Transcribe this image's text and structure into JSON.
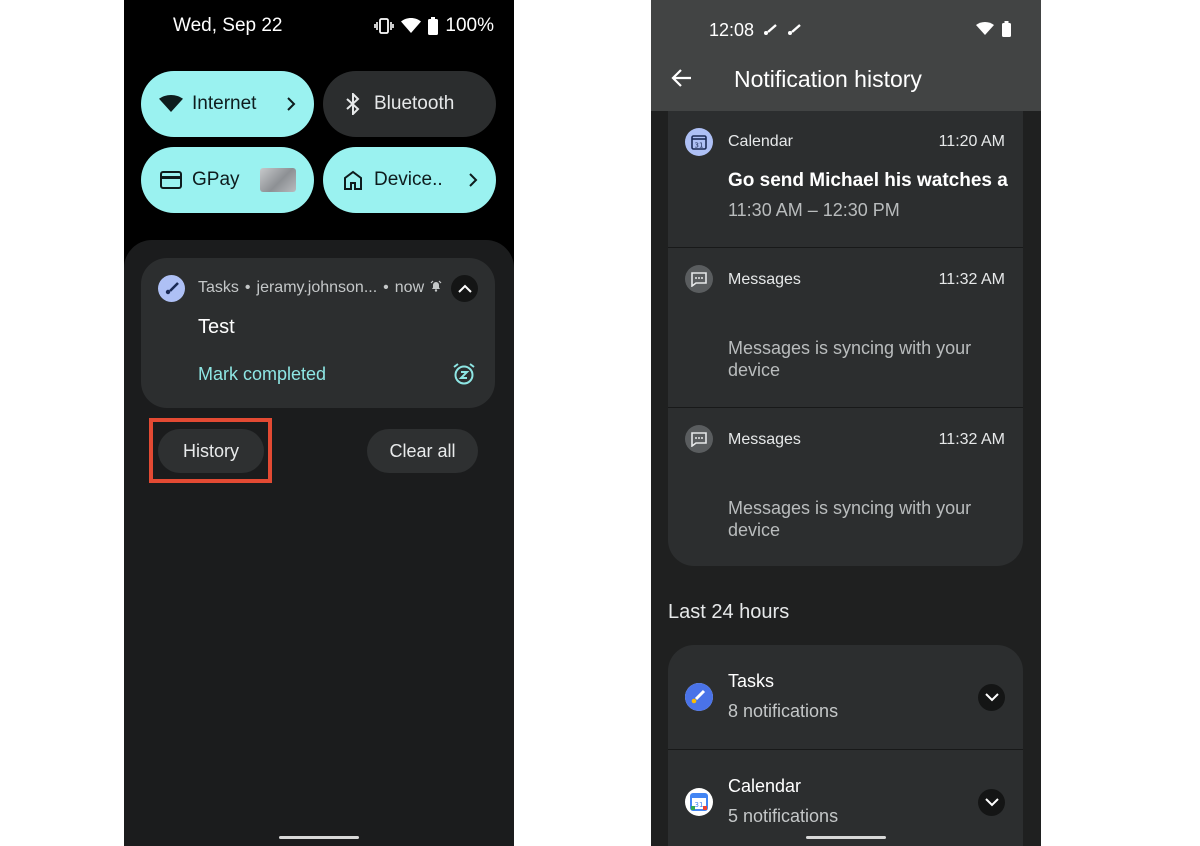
{
  "left": {
    "status": {
      "date": "Wed, Sep 22",
      "battery": "100%"
    },
    "tiles": [
      {
        "label": "Internet",
        "icon": "wifi-icon",
        "active": true
      },
      {
        "label": "Bluetooth",
        "icon": "bluetooth-icon",
        "active": false
      },
      {
        "label": "GPay",
        "icon": "wallet-card-icon",
        "active": true
      },
      {
        "label": "Device..",
        "icon": "home-icon",
        "active": true
      }
    ],
    "notification": {
      "app": "Tasks",
      "account": "jeramy.johnson...",
      "time": "now",
      "title": "Test",
      "action": "Mark completed",
      "icon": "tasks-check-icon"
    },
    "buttons": {
      "history": "History",
      "clear_all": "Clear all"
    },
    "colors": {
      "tile_active": "#9af2f0",
      "accent_text": "#8ee6e4",
      "highlight": "#e34a33"
    }
  },
  "right": {
    "status": {
      "time": "12:08"
    },
    "title": "Notification history",
    "items": [
      {
        "app": "Calendar",
        "time": "11:20 AM",
        "title": "Go send Michael his watches an...",
        "subtitle": "11:30 AM – 12:30 PM",
        "icon": "calendar-icon"
      },
      {
        "app": "Messages",
        "time": "11:32 AM",
        "body": "Messages is syncing with your device",
        "icon": "message-icon"
      },
      {
        "app": "Messages",
        "time": "11:32 AM",
        "body": "Messages is syncing with your device",
        "icon": "message-icon"
      }
    ],
    "section_title": "Last 24 hours",
    "history": [
      {
        "name": "Tasks",
        "count": "8 notifications",
        "icon": "tasks-check-icon"
      },
      {
        "name": "Calendar",
        "count": "5 notifications",
        "icon": "google-calendar-icon"
      }
    ]
  }
}
